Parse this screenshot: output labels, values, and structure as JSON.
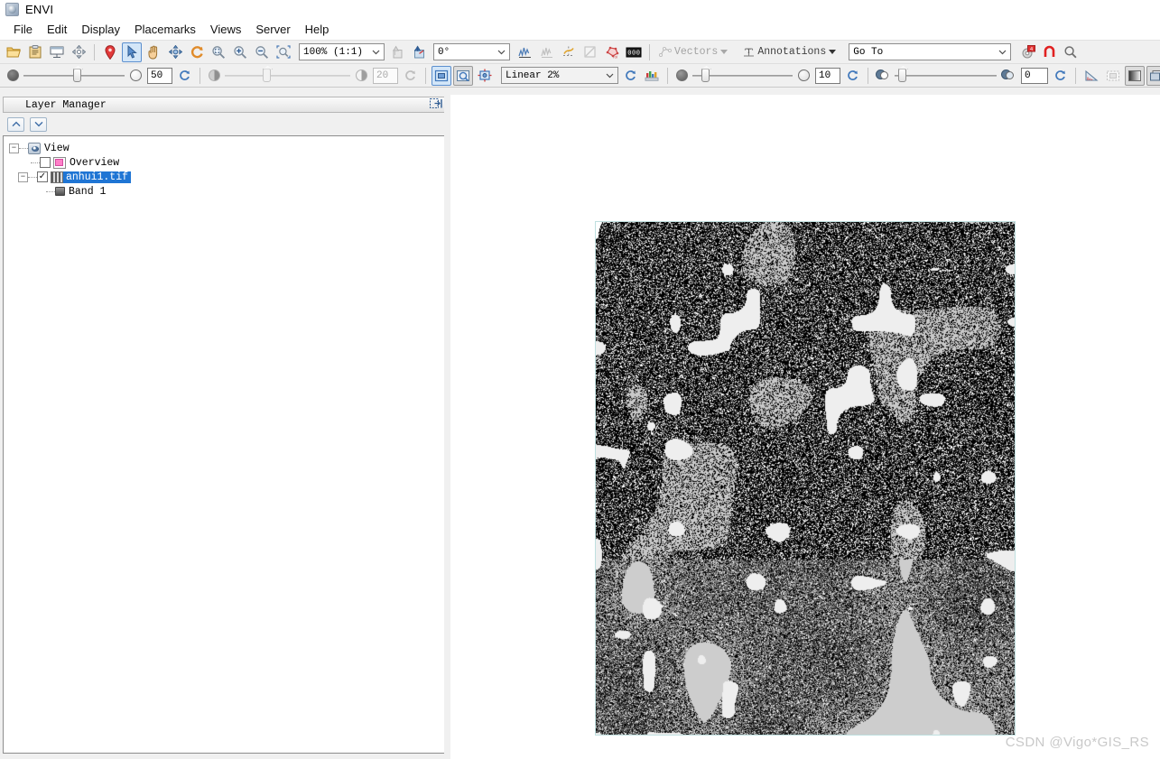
{
  "window": {
    "title": "ENVI",
    "icon": "envi-app-icon"
  },
  "menubar": {
    "items": [
      {
        "label": "File",
        "name": "menu-file"
      },
      {
        "label": "Edit",
        "name": "menu-edit"
      },
      {
        "label": "Display",
        "name": "menu-display"
      },
      {
        "label": "Placemarks",
        "name": "menu-placemarks"
      },
      {
        "label": "Views",
        "name": "menu-views"
      },
      {
        "label": "Server",
        "name": "menu-server"
      },
      {
        "label": "Help",
        "name": "menu-help"
      }
    ]
  },
  "toolbar_main": {
    "zoom_combo": {
      "value": "100% (1:1)",
      "name": "zoom-level-combo"
    },
    "rotation_combo": {
      "value": "0°",
      "name": "rotation-combo"
    },
    "vectors_button": {
      "label": "Vectors",
      "enabled": false
    },
    "annotations_button": {
      "label": "Annotations",
      "enabled": true
    },
    "goto_combo": {
      "value": "Go To",
      "placeholder": "Go To",
      "name": "go-to-combo"
    },
    "icons": [
      "open-file-icon",
      "paste-from-clipboard-icon",
      "display-window-icon",
      "crosshair-pan-icon",
      "placemark-pin-icon",
      "select-arrow-icon",
      "pan-hand-icon",
      "fly-navigate-icon",
      "rotate-icon",
      "zoom-to-extent-icon",
      "zoom-in-icon",
      "zoom-out-icon",
      "zoom-box-icon",
      "previous-view-icon",
      "next-view-icon",
      "spectral-profile-icon",
      "multi-profile-icon",
      "horizontal-profile-icon",
      "scatter-plot-icon",
      "roi-tool-icon",
      "pixel-value-icon",
      "preferences-badge-icon",
      "anomaly-icon",
      "search-icon"
    ]
  },
  "toolbar_stretch": {
    "transparency_value": "50",
    "brightness_value": "20",
    "stretch_combo": {
      "value": "Linear 2%",
      "name": "stretch-type-combo"
    },
    "sharpen_value": "10",
    "contrast_value": "0",
    "icons": [
      "transparency-dark-icon",
      "transparency-light-icon",
      "reset-transparency-icon",
      "brightness-dark-icon",
      "brightness-light-icon",
      "reset-brightness-icon",
      "stretch-on-view-icon",
      "stretch-on-layer-icon",
      "portal-icon",
      "reset-stretch-icon",
      "histogram-icon",
      "sharpen-dark-icon",
      "sharpen-light-icon",
      "reset-sharpen-icon",
      "contrast-dark-icon",
      "contrast-light-icon",
      "reset-contrast-icon",
      "measure-tool-icon",
      "crop-icon",
      "blend-icon",
      "flicker-icon",
      "swipe-icon",
      "data-manager-icon"
    ]
  },
  "layer_manager": {
    "title": "Layer Manager",
    "move_up_label": "▲",
    "move_down_label": "▼",
    "tree": [
      {
        "label": "View",
        "icon": "view-icon",
        "expanded": true,
        "checkbox": null,
        "selected": false,
        "depth": 0
      },
      {
        "label": "Overview",
        "icon": "overview-icon",
        "expanded": null,
        "checkbox": false,
        "selected": false,
        "depth": 1
      },
      {
        "label": "anhui1.tif",
        "icon": "raster-icon",
        "expanded": true,
        "checkbox": true,
        "selected": true,
        "depth": 1
      },
      {
        "label": "Band 1",
        "icon": "band-icon",
        "expanded": null,
        "checkbox": null,
        "selected": false,
        "depth": 2
      }
    ]
  },
  "view": {
    "raster_name": "anhui1.tif",
    "border_color": "#bfdfdf",
    "background_color": "#ffffff",
    "watermark": "CSDN @Vigo*GIS_RS"
  },
  "colors": {
    "accent": "#1f75d4",
    "toolbar_bg": "#f0f0f0",
    "panel_border": "#8a8a8a",
    "raster_border": "#bfdfdf",
    "selection": "#1f75d4",
    "watermark": "#c9c9c9"
  }
}
